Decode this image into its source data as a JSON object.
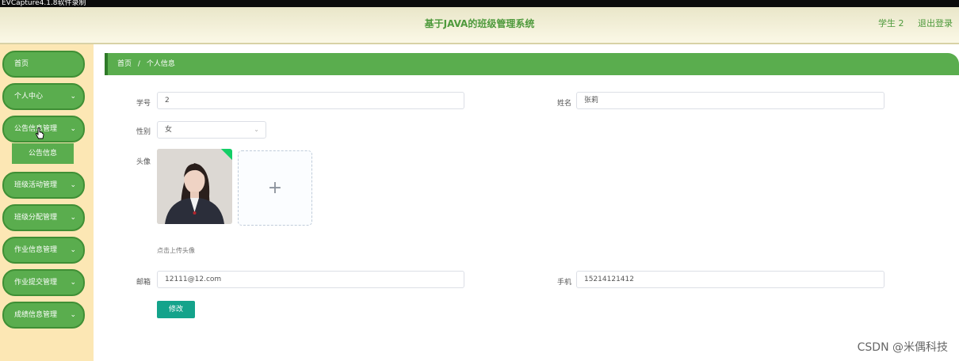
{
  "capture_bar": {
    "title": "EVCapture4.1.8软件录制"
  },
  "header": {
    "title": "基于JAVA的班级管理系统",
    "user": "学生 2",
    "logout": "退出登录"
  },
  "sidebar": {
    "items": [
      {
        "label": "首页",
        "has_chevron": false
      },
      {
        "label": "个人中心",
        "has_chevron": true
      },
      {
        "label": "公告信息管理",
        "has_chevron": true
      },
      {
        "label": "班级活动管理",
        "has_chevron": true
      },
      {
        "label": "班级分配管理",
        "has_chevron": true
      },
      {
        "label": "作业信息管理",
        "has_chevron": true
      },
      {
        "label": "作业提交管理",
        "has_chevron": true
      },
      {
        "label": "成绩信息管理",
        "has_chevron": true
      }
    ],
    "submenu": {
      "label": "公告信息"
    },
    "chevron_icon": "chevron-down-icon"
  },
  "breadcrumb": {
    "home": "首页",
    "separator": "/",
    "current": "个人信息"
  },
  "form": {
    "student_id_label": "学号",
    "student_id_value": "2",
    "name_label": "姓名",
    "name_value": "张莉",
    "gender_label": "性别",
    "gender_value": "女",
    "avatar_label": "头像",
    "upload_tip": "点击上传头像",
    "email_label": "邮箱",
    "email_value": "12111@12.com",
    "phone_label": "手机",
    "phone_value": "15214121412",
    "submit_label": "修改"
  },
  "watermark": "CSDN @米偶科技",
  "colors": {
    "accent": "#5aad4e",
    "sidebar_bg": "#fce7b4",
    "button": "#14a38b"
  }
}
